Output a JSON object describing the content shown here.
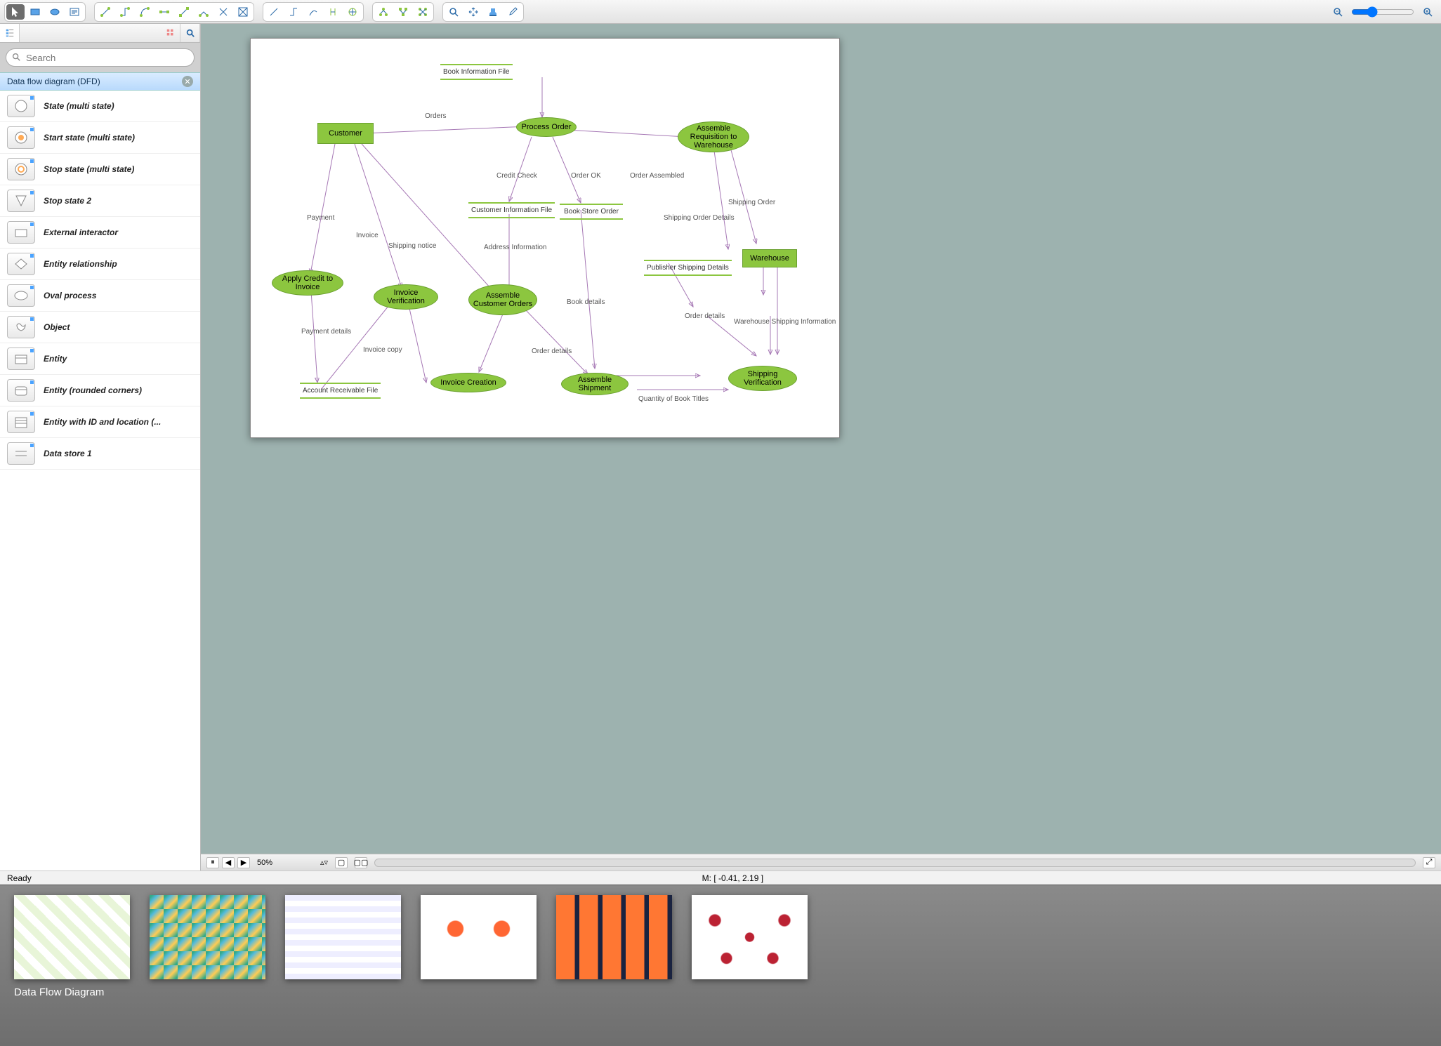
{
  "search": {
    "placeholder": "Search"
  },
  "library": {
    "title": "Data flow diagram (DFD)",
    "items": [
      "State (multi state)",
      "Start state (multi state)",
      "Stop state (multi state)",
      "Stop state 2",
      "External interactor",
      "Entity relationship",
      "Oval process",
      "Object",
      "Entity",
      "Entity (rounded corners)",
      "Entity with ID and location (...",
      "Data store 1"
    ]
  },
  "status": {
    "zoom": "50%",
    "ready": "Ready",
    "coords": "M: [ -0.41, 2.19 ]"
  },
  "gallery": {
    "title": "Data Flow Diagram"
  },
  "diagram": {
    "nodes": {
      "customer": "Customer",
      "process_order": "Process Order",
      "assemble_req": "Assemble Requisition to Warehouse",
      "warehouse": "Warehouse",
      "apply_credit": "Apply Credit to Invoice",
      "invoice_verif": "Invoice Verification",
      "assemble_cust": "Assemble Customer Orders",
      "invoice_creation": "Invoice Creation",
      "assemble_ship": "Assemble Shipment",
      "ship_verif": "Shipping Verification",
      "book_info": "Book Information File",
      "cust_info": "Customer Information File",
      "book_store": "Book Store Order",
      "pub_ship": "Publisher Shipping Details",
      "acct_recv": "Account Receivable File"
    },
    "edges": {
      "orders": "Orders",
      "credit_check": "Credit Check",
      "order_ok": "Order OK",
      "order_assembled": "Order Assembled",
      "shipping_order": "Shipping Order",
      "ship_order_det": "Shipping Order Details",
      "payment": "Payment",
      "invoice": "Invoice",
      "ship_notice": "Shipping notice",
      "addr_info": "Address Information",
      "book_details": "Book details",
      "order_details": "Order details",
      "order_details2": "Order details",
      "wh_ship_info": "Warehouse Shipping Information",
      "payment_details": "Payment details",
      "invoice_copy": "Invoice copy",
      "qty_titles": "Quantity of Book Titles"
    }
  }
}
